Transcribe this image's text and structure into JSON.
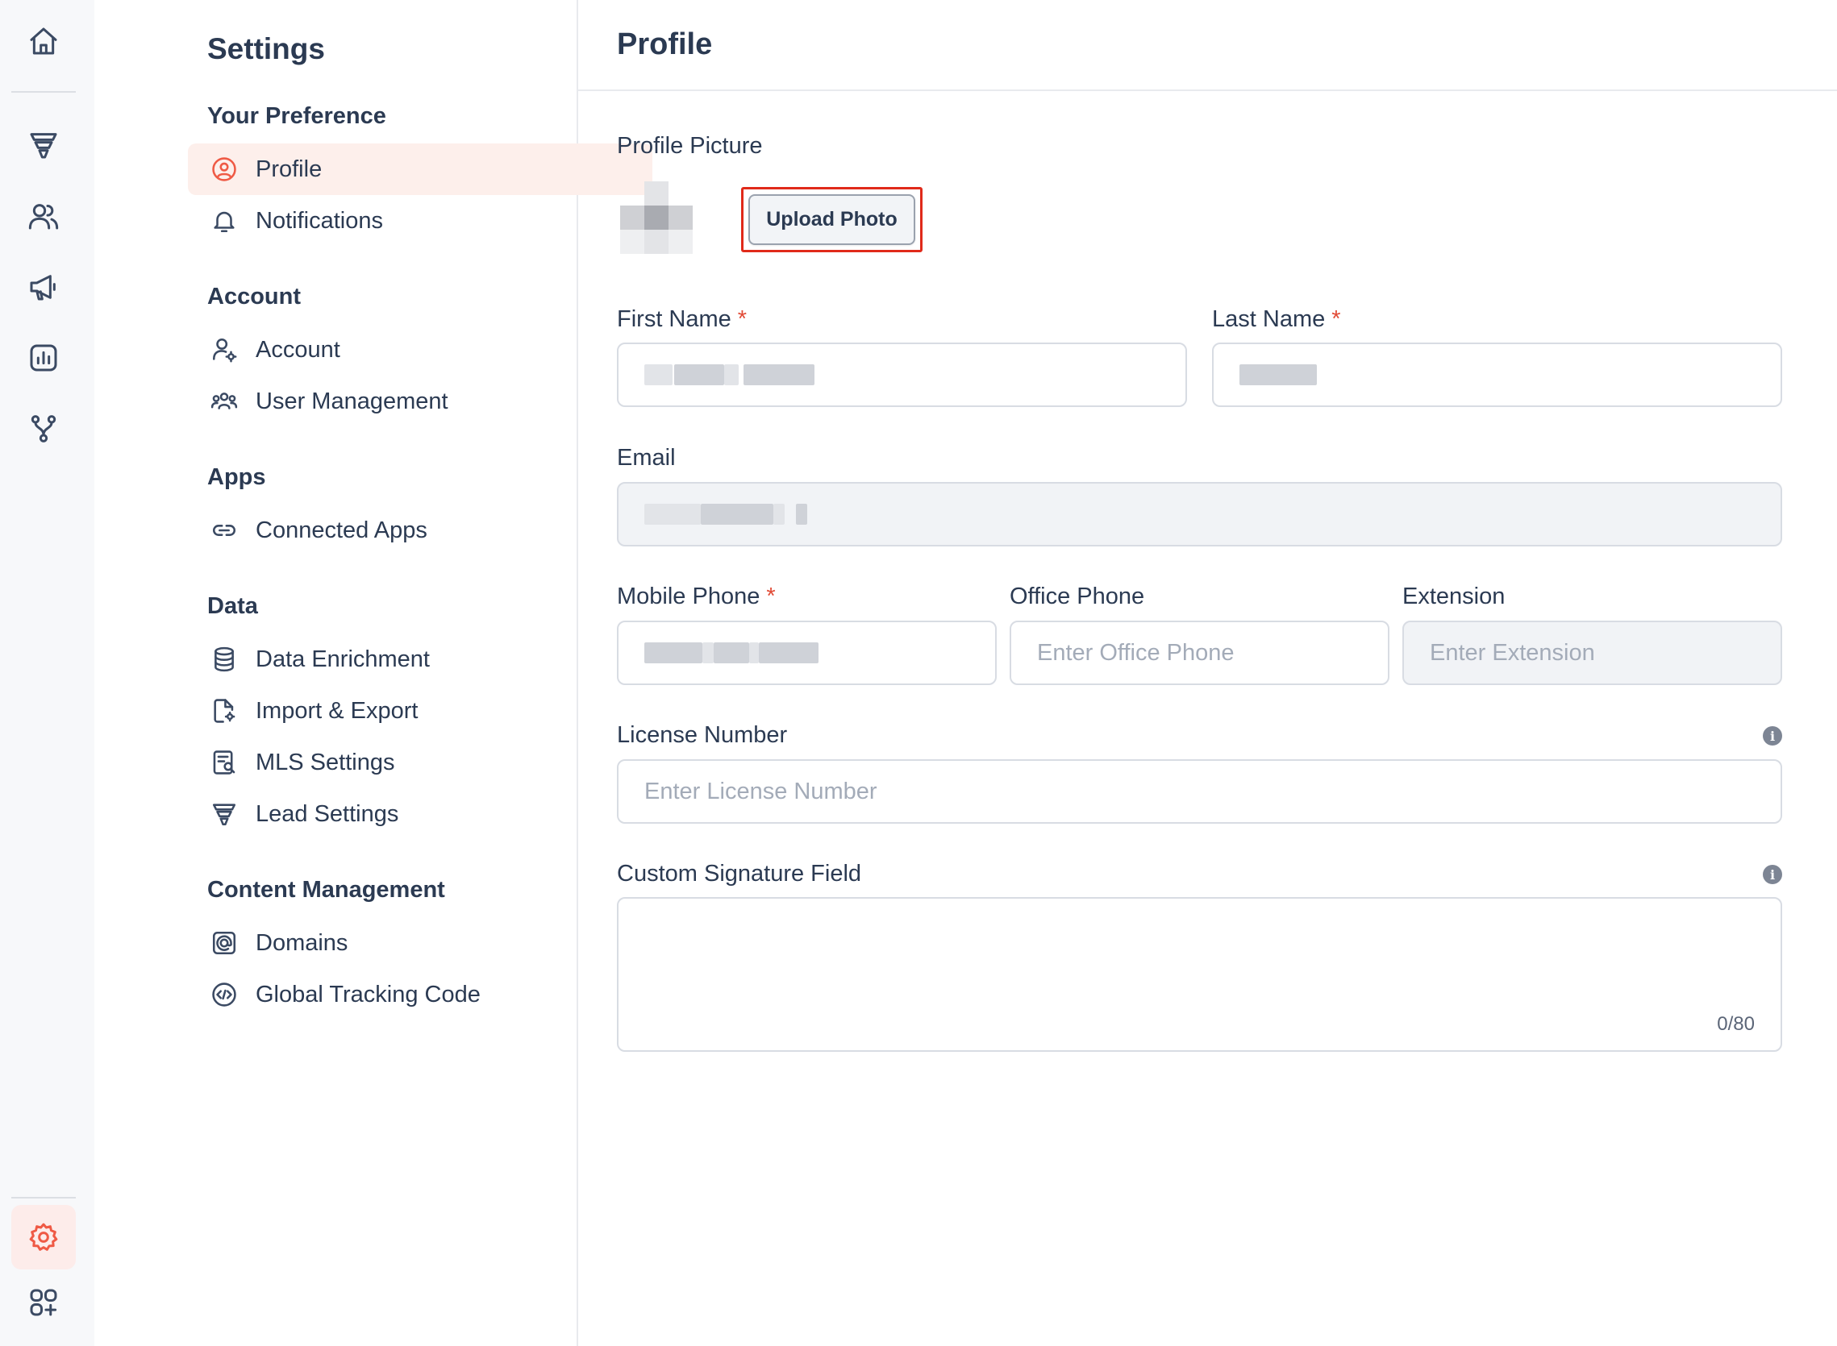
{
  "rail": {
    "icons": [
      "home-icon",
      "funnel-icon",
      "users-icon",
      "megaphone-icon",
      "chart-icon",
      "branch-icon",
      "gear-icon",
      "apps-icon"
    ],
    "active": "gear-icon",
    "accent": "#ef5a45"
  },
  "nav": {
    "title": "Settings",
    "sections": [
      {
        "title": "Your Preference",
        "items": [
          {
            "label": "Profile",
            "icon": "user-circle-icon",
            "active": true
          },
          {
            "label": "Notifications",
            "icon": "bell-icon"
          }
        ]
      },
      {
        "title": "Account",
        "items": [
          {
            "label": "Account",
            "icon": "user-gear-icon"
          },
          {
            "label": "User Management",
            "icon": "team-icon"
          }
        ]
      },
      {
        "title": "Apps",
        "items": [
          {
            "label": "Connected Apps",
            "icon": "link-icon"
          }
        ]
      },
      {
        "title": "Data",
        "items": [
          {
            "label": "Data Enrichment",
            "icon": "database-icon"
          },
          {
            "label": "Import & Export",
            "icon": "file-gear-icon"
          },
          {
            "label": "MLS Settings",
            "icon": "document-search-icon"
          },
          {
            "label": "Lead Settings",
            "icon": "funnel-icon"
          }
        ]
      },
      {
        "title": "Content Management",
        "items": [
          {
            "label": "Domains",
            "icon": "at-sign-icon"
          },
          {
            "label": "Global Tracking Code",
            "icon": "code-circle-icon"
          }
        ]
      }
    ]
  },
  "main": {
    "title": "Profile",
    "profile_picture_label": "Profile Picture",
    "upload_button": "Upload Photo",
    "first_name_label": "First Name",
    "last_name_label": "Last Name",
    "email_label": "Email",
    "mobile_phone_label": "Mobile Phone",
    "office_phone_label": "Office Phone",
    "office_phone_placeholder": "Enter Office Phone",
    "extension_label": "Extension",
    "extension_placeholder": "Enter Extension",
    "license_label": "License Number",
    "license_placeholder": "Enter License Number",
    "signature_label": "Custom Signature Field",
    "signature_counter": "0/80",
    "required_mark": "*",
    "info_glyph": "i"
  }
}
